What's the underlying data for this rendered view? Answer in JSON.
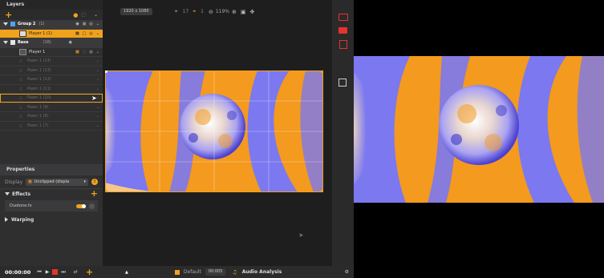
{
  "layers_panel": {
    "title": "Layers",
    "rows": [
      {
        "label": "Group 2",
        "count": "(1)",
        "type": "group"
      },
      {
        "label": "Player 1 (1)",
        "type": "selected"
      },
      {
        "label": "Base",
        "count": "(16)",
        "type": "group"
      },
      {
        "label": "Player 1",
        "type": "normal"
      },
      {
        "label": "Pawn 1 (14)",
        "type": "dim"
      },
      {
        "label": "Pawn 1 (13)",
        "type": "dim"
      },
      {
        "label": "Pawn 1 (12)",
        "type": "dim"
      },
      {
        "label": "Pawn 1 (11)",
        "type": "dim"
      },
      {
        "label": "Pawn 1 (10)",
        "type": "dim-outline"
      },
      {
        "label": "Pawn 1 (9)",
        "type": "dim"
      },
      {
        "label": "Pawn 1 (8)",
        "type": "dim"
      },
      {
        "label": "Pawn 1 (7)",
        "type": "dim"
      }
    ]
  },
  "properties": {
    "title": "Properties",
    "display_label": "Display",
    "display_value": "Unclipped (displa",
    "effects_label": "Effects",
    "effect_item": "Duotone.fx",
    "warping_label": "Warping"
  },
  "viewport": {
    "resolution": "1920 x 1080",
    "zoom": "119%",
    "grid_a": "17",
    "grid_b": "1"
  },
  "bottom_bar": {
    "timecode": "00:00:00",
    "default_label": "Default",
    "frame_value": "00:005",
    "audio_label": "Audio Analysis"
  },
  "colors": {
    "accent": "#f0a21c",
    "red": "#e8322c",
    "wave_orange": "#f39a1f",
    "wave_purple": "#7b78f0"
  }
}
